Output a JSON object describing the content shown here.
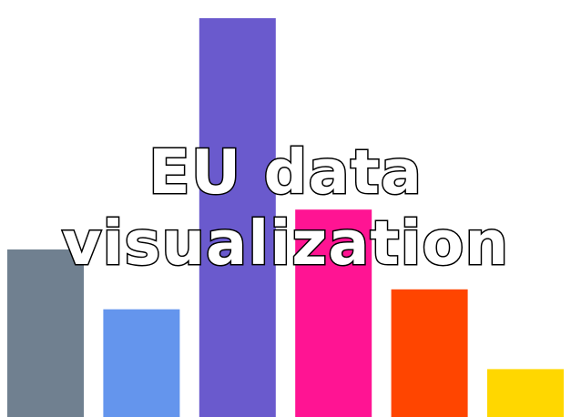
{
  "logo": {
    "line1": "EU data",
    "line2": "visualization"
  },
  "chart_data": {
    "type": "bar",
    "title": "",
    "xlabel": "",
    "ylabel": "",
    "grid": false,
    "ylim": [
      0,
      100
    ],
    "categories": [
      "",
      "",
      "",
      "",
      "",
      ""
    ],
    "values": [
      42,
      27,
      100,
      52,
      32,
      12
    ],
    "colors": [
      "#708090",
      "#6495ED",
      "#6A5ACD",
      "#FF1493",
      "#FF4500",
      "#FFD700"
    ]
  }
}
